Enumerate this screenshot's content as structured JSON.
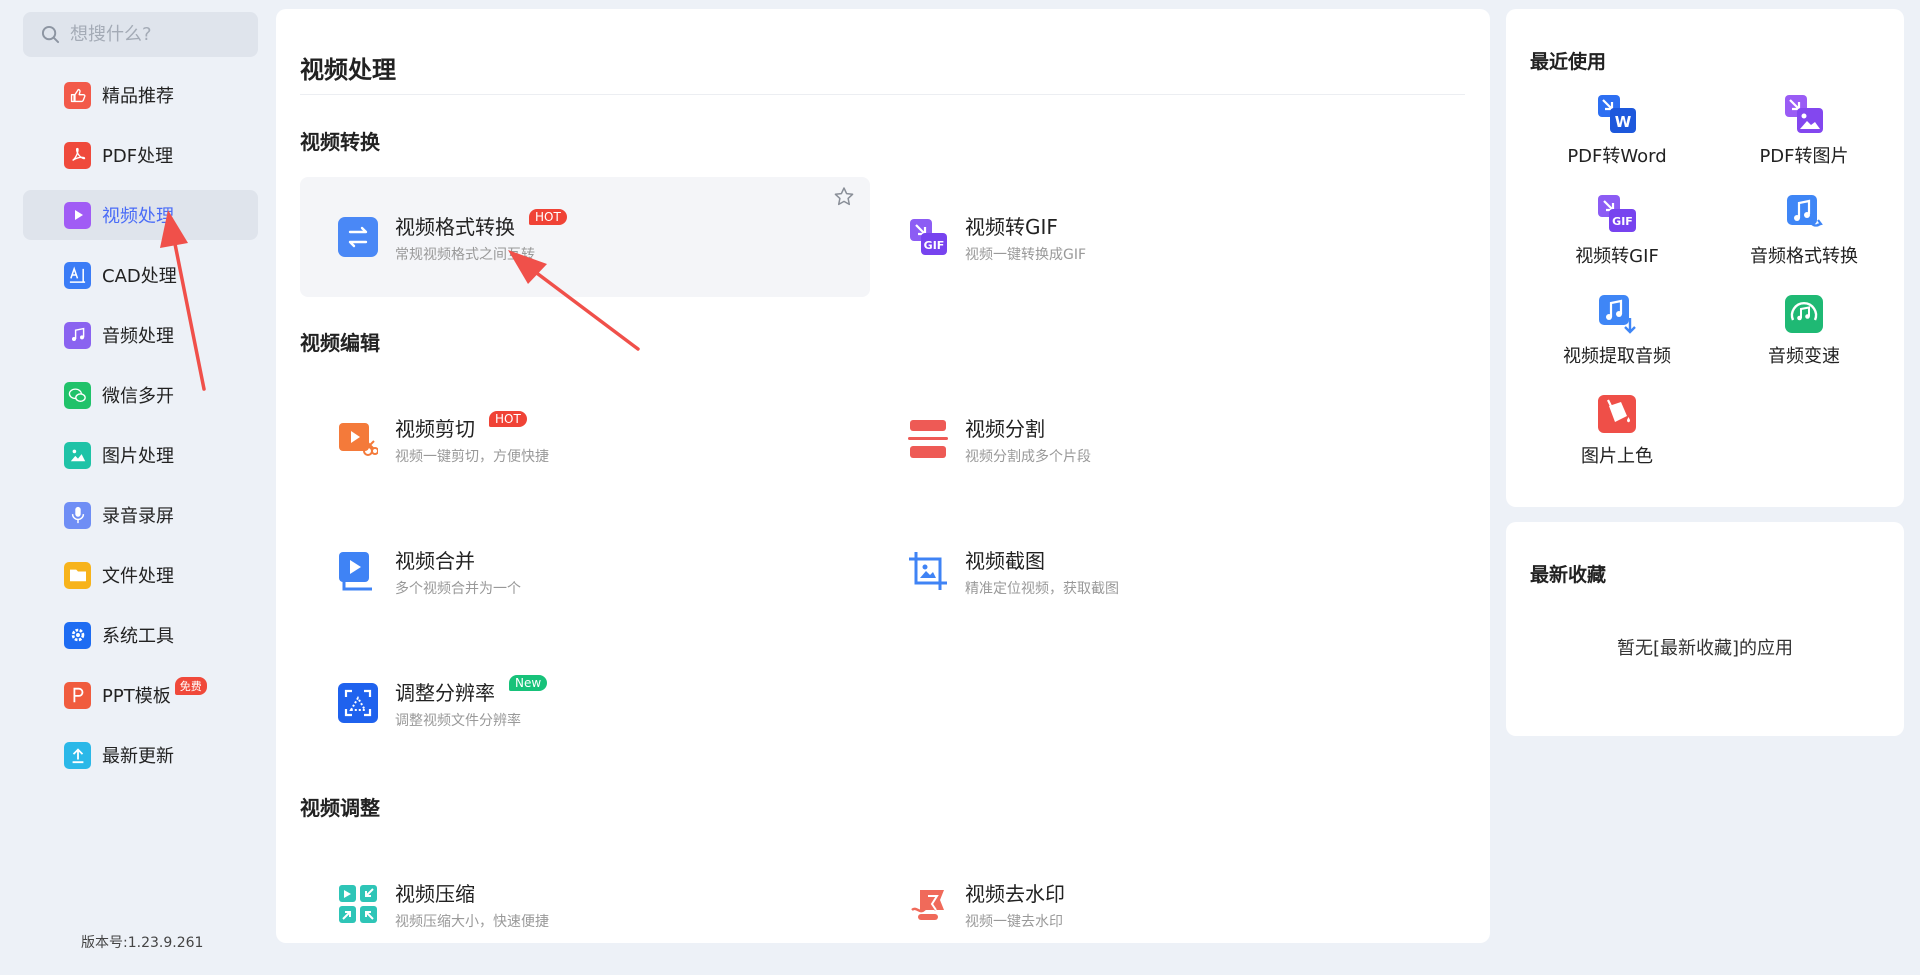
{
  "search": {
    "placeholder": "想搜什么?"
  },
  "sidebar": {
    "items": [
      {
        "label": "精品推荐",
        "icon": "thumbs-up-icon",
        "color": "#f25a4a"
      },
      {
        "label": "PDF处理",
        "icon": "pdf-icon",
        "color": "#ef4a3c"
      },
      {
        "label": "视频处理",
        "icon": "play-icon",
        "color": "#a15cf5",
        "active": true
      },
      {
        "label": "CAD处理",
        "icon": "cad-icon",
        "color": "#3b7cf6"
      },
      {
        "label": "音频处理",
        "icon": "music-note-icon",
        "color": "#8a63f0"
      },
      {
        "label": "微信多开",
        "icon": "wechat-icon",
        "color": "#20c26a"
      },
      {
        "label": "图片处理",
        "icon": "image-icon",
        "color": "#1fc3a7"
      },
      {
        "label": "录音录屏",
        "icon": "microphone-icon",
        "color": "#6f8ef5"
      },
      {
        "label": "文件处理",
        "icon": "folder-icon",
        "color": "#f7b31b"
      },
      {
        "label": "系统工具",
        "icon": "gear-icon",
        "color": "#1e6cf2"
      },
      {
        "label": "PPT模板",
        "icon": "ppt-icon",
        "color": "#f05c3e",
        "badge": "免费"
      },
      {
        "label": "最新更新",
        "icon": "upload-icon",
        "color": "#2bb8e8"
      }
    ]
  },
  "version": "版本号:1.23.9.261",
  "main": {
    "title": "视频处理",
    "sections": [
      {
        "title": "视频转换",
        "tools": [
          {
            "name": "视频格式转换",
            "desc": "常规视频格式之间互转",
            "tag": "HOT",
            "icon": "convert-arrows-icon"
          },
          {
            "name": "视频转GIF",
            "desc": "视频一键转换成GIF",
            "icon": "video-gif-icon"
          }
        ]
      },
      {
        "title": "视频编辑",
        "tools": [
          {
            "name": "视频剪切",
            "desc": "视频一键剪切，方便快捷",
            "tag": "HOT",
            "icon": "video-cut-icon"
          },
          {
            "name": "视频分割",
            "desc": "视频分割成多个片段",
            "icon": "video-split-icon"
          },
          {
            "name": "视频合并",
            "desc": "多个视频合并为一个",
            "icon": "video-merge-icon"
          },
          {
            "name": "视频截图",
            "desc": "精准定位视频，获取截图",
            "icon": "video-screenshot-icon"
          },
          {
            "name": "调整分辨率",
            "desc": "调整视频文件分辨率",
            "tag": "New",
            "icon": "resolution-icon"
          }
        ]
      },
      {
        "title": "视频调整",
        "tools": [
          {
            "name": "视频压缩",
            "desc": "视频压缩大小，快速便捷",
            "icon": "compress-icon"
          },
          {
            "name": "视频去水印",
            "desc": "视频一键去水印",
            "icon": "watermark-remove-icon"
          }
        ]
      }
    ]
  },
  "recent": {
    "title": "最近使用",
    "items": [
      {
        "label": "PDF转Word",
        "icon": "pdf-to-word-icon"
      },
      {
        "label": "PDF转图片",
        "icon": "pdf-to-image-icon"
      },
      {
        "label": "视频转GIF",
        "icon": "video-gif-icon"
      },
      {
        "label": "音频格式转换",
        "icon": "audio-convert-icon"
      },
      {
        "label": "视频提取音频",
        "icon": "extract-audio-icon"
      },
      {
        "label": "音频变速",
        "icon": "audio-speed-icon"
      },
      {
        "label": "图片上色",
        "icon": "colorize-icon"
      }
    ]
  },
  "favorites": {
    "title": "最新收藏",
    "empty_text": "暂无[最新收藏]的应用"
  },
  "colors": {
    "accent": "#4a6cf7",
    "hot": "#f04336",
    "new": "#17c27a",
    "annotation": "#f0504a"
  }
}
